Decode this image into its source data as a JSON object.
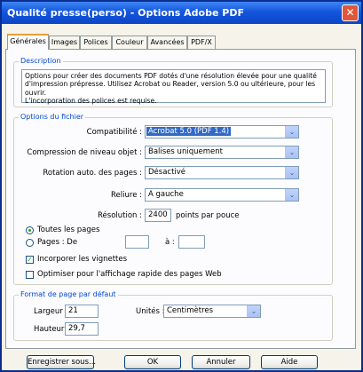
{
  "window": {
    "title": "Qualité presse(perso) - Options Adobe PDF"
  },
  "tabs": [
    "Générales",
    "Images",
    "Polices",
    "Couleur",
    "Avancées",
    "PDF/X"
  ],
  "description": {
    "legend": "Description",
    "lines": [
      "Options pour créer des documents PDF dotés d'une résolution élevée pour une qualité",
      "d'impression prépresse. Utilisez Acrobat ou Reader, version 5.0 ou ultérieure, pour les ouvrir.",
      "L'incorporation des polices est requise."
    ]
  },
  "file_options": {
    "legend": "Options du fichier",
    "compat_label": "Compatibilité :",
    "compat_value": "Acrobat 5.0 (PDF 1.4)",
    "compression_label": "Compression de niveau objet :",
    "compression_value": "Balises uniquement",
    "rotation_label": "Rotation auto. des pages :",
    "rotation_value": "Désactivé",
    "binding_label": "Reliure :",
    "binding_value": "A gauche",
    "resolution_label": "Résolution :",
    "resolution_value": "2400",
    "resolution_unit": "points par pouce",
    "all_pages": "Toutes les pages",
    "pages_from": "Pages : De",
    "pages_to": "à :",
    "thumbnails": "Incorporer les vignettes",
    "web_optimize": "Optimiser pour l'affichage rapide des pages Web"
  },
  "page_format": {
    "legend": "Format de page par défaut",
    "width_label": "Largeur :",
    "width_value": "21",
    "units_label": "Unités :",
    "units_value": "Centimètres",
    "height_label": "Hauteur :",
    "height_value": "29,7"
  },
  "buttons": {
    "save_as": "Enregistrer sous...",
    "ok": "OK",
    "cancel": "Annuler",
    "help": "Aide"
  },
  "colors": {
    "titlebar": "#1356dd",
    "legend": "#0046d5",
    "selection": "#316ac5"
  }
}
